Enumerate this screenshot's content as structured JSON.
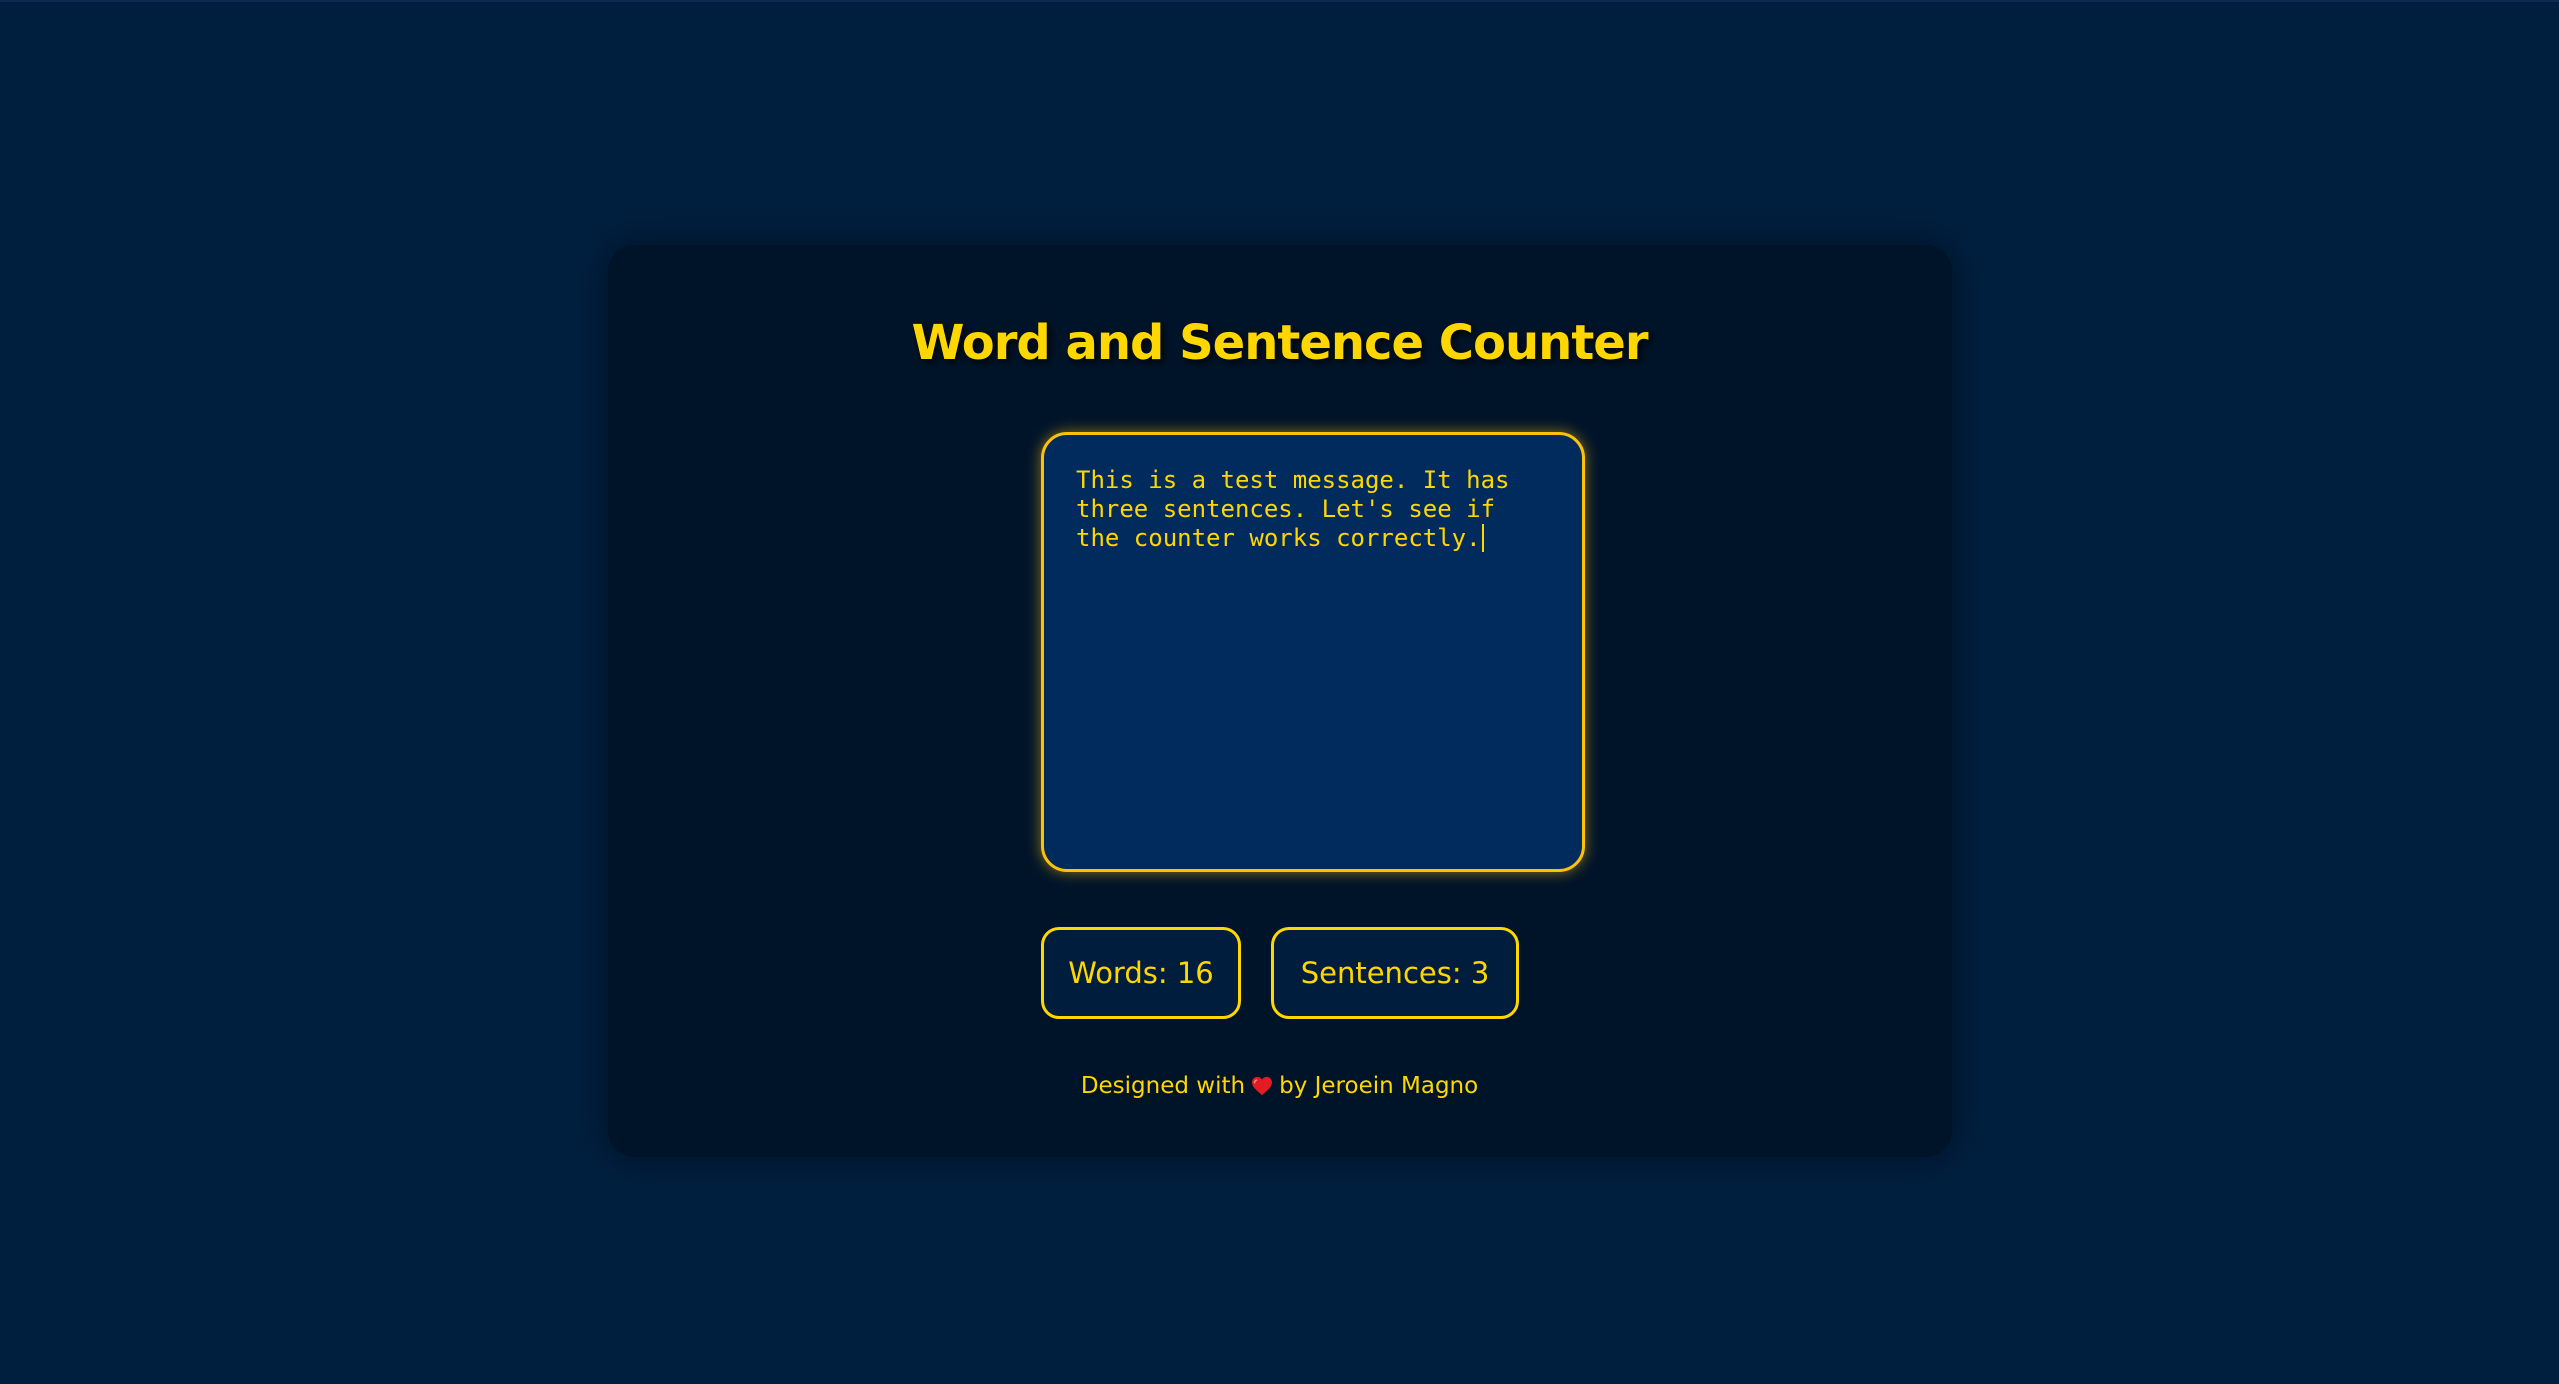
{
  "app": {
    "title": "Word and Sentence Counter"
  },
  "editor": {
    "text": "This is a test message. It has three sentences. Let's see if the counter works correctly."
  },
  "stats": {
    "words_label": "Words:",
    "words_value": "16",
    "sentences_label": "Sentences:",
    "sentences_value": "3"
  },
  "footer": {
    "prefix": "Designed with",
    "icon": "heart-icon",
    "suffix": "by Jeroein Magno"
  },
  "colors": {
    "background": "#001f3f",
    "card": "#001429",
    "accent": "#ffd700",
    "textarea_bg": "#002b5c",
    "heart": "#e31b23"
  }
}
